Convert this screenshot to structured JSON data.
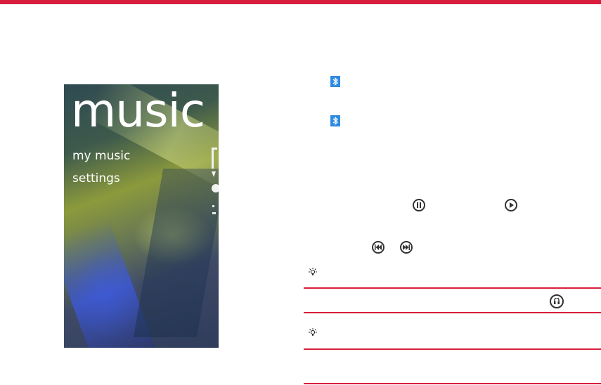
{
  "phone": {
    "title": "music",
    "menu": [
      "my music",
      "settings"
    ]
  },
  "colors": {
    "accent": "#d81e3c",
    "bluetooth": "#2e8be0"
  },
  "icons": [
    "bluetooth-icon",
    "bluetooth-icon",
    "pause-icon",
    "play-icon",
    "previous-icon",
    "next-icon",
    "tip-icon",
    "headset-icon",
    "tip-icon"
  ]
}
